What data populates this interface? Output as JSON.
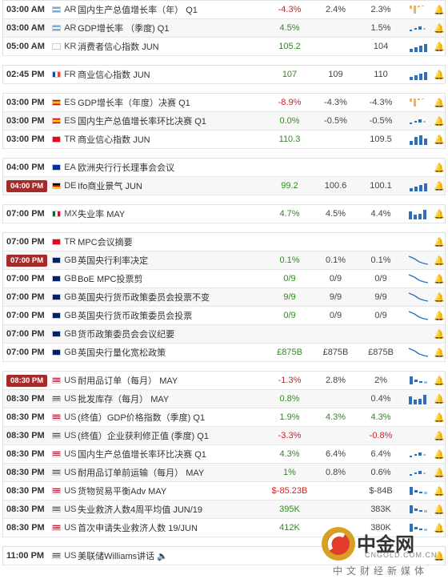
{
  "colors": {
    "positive": "#2e8b1e",
    "negative": "#d02222",
    "highlight_time_bg": "#a52a2a"
  },
  "groups": [
    {
      "rows": [
        {
          "time": "03:00 AM",
          "flag": "ar",
          "cc": "AR",
          "event": "国内生产总值增长率（年） Q1",
          "actual": "-4.3%",
          "actual_color": "red",
          "forecast": "2.4%",
          "previous": "2.3%",
          "spark": "bars-up-down"
        },
        {
          "time": "03:00 AM",
          "flag": "ar",
          "cc": "AR",
          "event": "GDP增长率 （季度) Q1",
          "actual": "4.5%",
          "actual_color": "green",
          "forecast": "",
          "previous": "1.5%",
          "spark": "dots"
        },
        {
          "time": "05:00 AM",
          "flag": "kr",
          "cc": "KR",
          "event": "消费者信心指数 JUN",
          "actual": "105.2",
          "actual_color": "green",
          "forecast": "",
          "previous": "104",
          "spark": "bars-rise"
        }
      ]
    },
    {
      "rows": [
        {
          "time": "02:45 PM",
          "flag": "fr",
          "cc": "FR",
          "event": "商业信心指数 JUN",
          "actual": "107",
          "actual_color": "green",
          "forecast": "109",
          "previous": "110",
          "spark": "bars-rise"
        }
      ]
    },
    {
      "rows": [
        {
          "time": "03:00 PM",
          "flag": "es",
          "cc": "ES",
          "event": "GDP增长率（年度）决赛 Q1",
          "actual": "-8.9%",
          "actual_color": "red",
          "forecast": "-4.3%",
          "previous": "-4.3%",
          "spark": "bars-up-down"
        },
        {
          "time": "03:00 PM",
          "flag": "es",
          "cc": "ES",
          "event": "国内生产总值增长率环比决赛 Q1",
          "actual": "0.0%",
          "actual_color": "green",
          "forecast": "-0.5%",
          "previous": "-0.5%",
          "spark": "dots"
        },
        {
          "time": "03:00 PM",
          "flag": "tr",
          "cc": "TR",
          "event": "商业信心指数 JUN",
          "actual": "110.3",
          "actual_color": "green",
          "forecast": "",
          "previous": "109.5",
          "spark": "bars-mixed"
        }
      ]
    },
    {
      "rows": [
        {
          "time": "04:00 PM",
          "flag": "ea",
          "cc": "EA",
          "event": "欧洲央行行长理事会会议",
          "actual": "",
          "actual_color": "gray",
          "forecast": "",
          "previous": "",
          "spark": "none"
        },
        {
          "time": "04:00 PM",
          "time_highlight": true,
          "flag": "de",
          "cc": "DE",
          "event": "Ifo商业景气 JUN",
          "actual": "99.2",
          "actual_color": "green",
          "forecast": "100.6",
          "previous": "100.1",
          "spark": "bars-rise"
        }
      ]
    },
    {
      "rows": [
        {
          "time": "07:00 PM",
          "flag": "mx",
          "cc": "MX",
          "event": "失业率 MAY",
          "actual": "4.7%",
          "actual_color": "green",
          "forecast": "4.5%",
          "previous": "4.4%",
          "spark": "bars-big"
        }
      ]
    },
    {
      "rows": [
        {
          "time": "07:00 PM",
          "flag": "tr",
          "cc": "TR",
          "event": "MPC会议摘要",
          "actual": "",
          "actual_color": "gray",
          "forecast": "",
          "previous": "",
          "spark": "none"
        },
        {
          "time": "07:00 PM",
          "time_highlight": true,
          "flag": "gb",
          "cc": "GB",
          "event": "英国央行利率决定",
          "actual": "0.1%",
          "actual_color": "green",
          "forecast": "0.1%",
          "previous": "0.1%",
          "spark": "line-down"
        },
        {
          "time": "07:00 PM",
          "flag": "gb",
          "cc": "GB",
          "event": "BoE MPC投票剪",
          "actual": "0/9",
          "actual_color": "green",
          "forecast": "0/9",
          "previous": "0/9",
          "spark": "line-down"
        },
        {
          "time": "07:00 PM",
          "flag": "gb",
          "cc": "GB",
          "event": "英国央行货币政策委员会投票不变",
          "actual": "9/9",
          "actual_color": "green",
          "forecast": "9/9",
          "previous": "9/9",
          "spark": "line-down"
        },
        {
          "time": "07:00 PM",
          "flag": "gb",
          "cc": "GB",
          "event": "英国央行货币政策委员会投票",
          "actual": "0/9",
          "actual_color": "green",
          "forecast": "0/9",
          "previous": "0/9",
          "spark": "line-down"
        },
        {
          "time": "07:00 PM",
          "flag": "gb",
          "cc": "GB",
          "event": "货币政策委员会会议纪要",
          "actual": "",
          "actual_color": "gray",
          "forecast": "",
          "previous": "",
          "spark": "none"
        },
        {
          "time": "07:00 PM",
          "flag": "gb",
          "cc": "GB",
          "event": "英国央行量化宽松政策",
          "actual": "£875B",
          "actual_color": "green",
          "forecast": "£875B",
          "previous": "£875B",
          "spark": "line-down"
        }
      ]
    },
    {
      "rows": [
        {
          "time": "08:30 PM",
          "time_highlight": true,
          "flag": "us",
          "cc": "US",
          "event": "耐用品订单（每月） MAY",
          "actual": "-1.3%",
          "actual_color": "red",
          "forecast": "2.8%",
          "previous": "2%",
          "spark": "bars-down"
        },
        {
          "time": "08:30 PM",
          "flag": "us",
          "cc": "US",
          "event": "批发库存（每月） MAY",
          "actual": "0.8%",
          "actual_color": "green",
          "forecast": "",
          "previous": "0.4%",
          "spark": "bars-big"
        },
        {
          "time": "08:30 PM",
          "flag": "us",
          "cc": "US",
          "event": "(终值）GDP价格指数（季度) Q1",
          "actual": "1.9%",
          "actual_color": "green",
          "forecast": "4.3%",
          "forecast_color": "green",
          "previous": "4.3%",
          "previous_color": "green",
          "spark": "none"
        },
        {
          "time": "08:30 PM",
          "flag": "us",
          "cc": "US",
          "event": "(终值）企业获利修正值 (季度) Q1",
          "actual": "-3.3%",
          "actual_color": "red",
          "forecast": "",
          "previous": "-0.8%",
          "previous_color": "red",
          "spark": "none"
        },
        {
          "time": "08:30 PM",
          "flag": "us",
          "cc": "US",
          "event": "国内生产总值增长率环比决赛 Q1",
          "actual": "4.3%",
          "actual_color": "green",
          "forecast": "6.4%",
          "previous": "6.4%",
          "spark": "dots"
        },
        {
          "time": "08:30 PM",
          "flag": "us",
          "cc": "US",
          "event": "耐用品订单前运输（每月） MAY",
          "actual": "1%",
          "actual_color": "green",
          "forecast": "0.8%",
          "previous": "0.6%",
          "spark": "dots"
        },
        {
          "time": "08:30 PM",
          "flag": "us",
          "cc": "US",
          "event": "货物贸易平衡Adv MAY",
          "actual": "$-85.23B",
          "actual_color": "red",
          "forecast": "",
          "previous": "$-84B",
          "spark": "bars-down"
        },
        {
          "time": "08:30 PM",
          "flag": "us",
          "cc": "US",
          "event": "失业救济人数4周平均值 JUN/19",
          "actual": "395K",
          "actual_color": "green",
          "forecast": "",
          "previous": "383K",
          "spark": "bars-down"
        },
        {
          "time": "08:30 PM",
          "flag": "us",
          "cc": "US",
          "event": "首次申请失业救济人数 19/JUN",
          "actual": "412K",
          "actual_color": "green",
          "forecast": "",
          "previous": "380K",
          "spark": "bars-down"
        }
      ]
    },
    {
      "rows": [
        {
          "time": "11:00 PM",
          "flag": "us",
          "cc": "US",
          "event": "美联储Williams讲话",
          "event_suffix_icon": "speaker-icon",
          "actual": "",
          "actual_color": "gray",
          "forecast": "",
          "previous": "",
          "spark": "none"
        }
      ]
    }
  ],
  "watermark": {
    "title": "中金网",
    "url": "CNGOLD.COM.CN",
    "subtitle": "中文财经新媒体"
  }
}
